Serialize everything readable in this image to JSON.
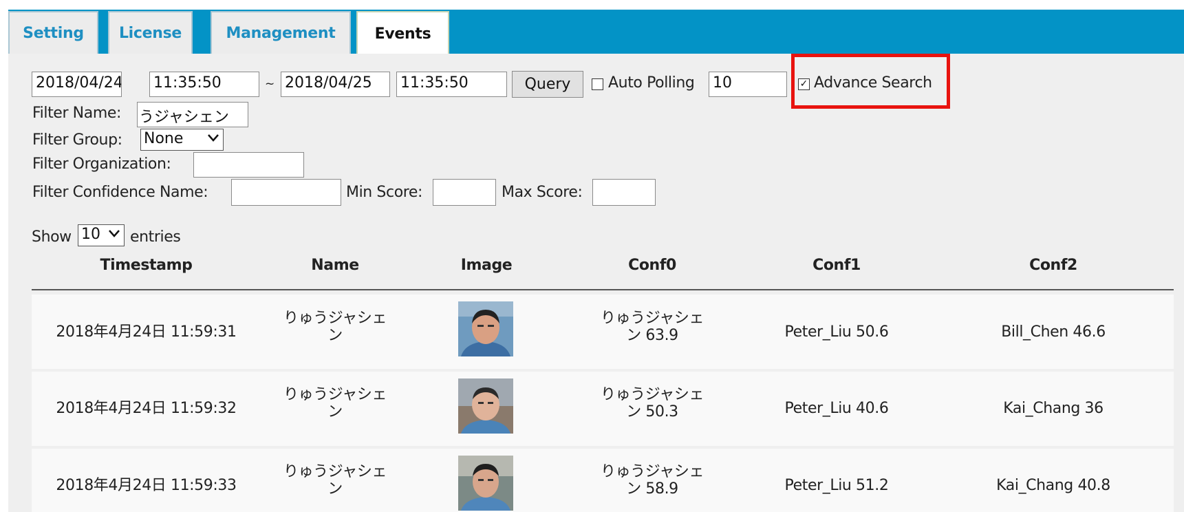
{
  "tabs": [
    {
      "label": "Setting",
      "active": false
    },
    {
      "label": "License",
      "active": false
    },
    {
      "label": "Management",
      "active": false
    },
    {
      "label": "Events",
      "active": true
    }
  ],
  "query": {
    "start_date": "2018/04/24",
    "start_time": "11:35:50",
    "range_separator": "~",
    "end_date": "2018/04/25",
    "end_time": "11:35:50",
    "query_label": "Query",
    "auto_polling_label": "Auto Polling",
    "auto_polling_checked": false,
    "auto_polling_value": "10",
    "advance_search_label": "Advance Search",
    "advance_search_checked": true
  },
  "filters": {
    "name_label": "Filter Name:",
    "name_value": "うジャシェン",
    "group_label": "Filter Group:",
    "group_value": "None",
    "organization_label": "Filter Organization:",
    "organization_value": "",
    "confidence_name_label": "Filter Confidence Name:",
    "confidence_name_value": "",
    "min_score_label": "Min Score:",
    "min_score_value": "",
    "max_score_label": "Max Score:",
    "max_score_value": ""
  },
  "entries": {
    "show_label": "Show",
    "page_size": "10",
    "entries_label": "entries"
  },
  "table": {
    "columns": [
      "Timestamp",
      "Name",
      "Image",
      "Conf0",
      "Conf1",
      "Conf2"
    ],
    "rows": [
      {
        "timestamp": "2018年4月24日 11:59:31",
        "name_line1": "りゅうジャシェ",
        "name_line2": "ン",
        "conf0_line1": "りゅうジャシェ",
        "conf0_line2": "ン 63.9",
        "conf1": "Peter_Liu 50.6",
        "conf2": "Bill_Chen 46.6"
      },
      {
        "timestamp": "2018年4月24日 11:59:32",
        "name_line1": "りゅうジャシェ",
        "name_line2": "ン",
        "conf0_line1": "りゅうジャシェ",
        "conf0_line2": "ン 50.3",
        "conf1": "Peter_Liu 40.6",
        "conf2": "Kai_Chang 36"
      },
      {
        "timestamp": "2018年4月24日 11:59:33",
        "name_line1": "りゅうジャシェ",
        "name_line2": "ン",
        "conf0_line1": "りゅうジャシェ",
        "conf0_line2": "ン 58.9",
        "conf1": "Peter_Liu 51.2",
        "conf2": "Kai_Chang 40.8"
      }
    ]
  },
  "colors": {
    "tabbar": "#0393c6",
    "tab_text": "#1e8fc2",
    "highlight_border": "#e8130f",
    "content_bg": "#efefef"
  },
  "icons": {
    "dropdown": "chevron-down-icon",
    "checkbox": "checkbox-icon"
  }
}
